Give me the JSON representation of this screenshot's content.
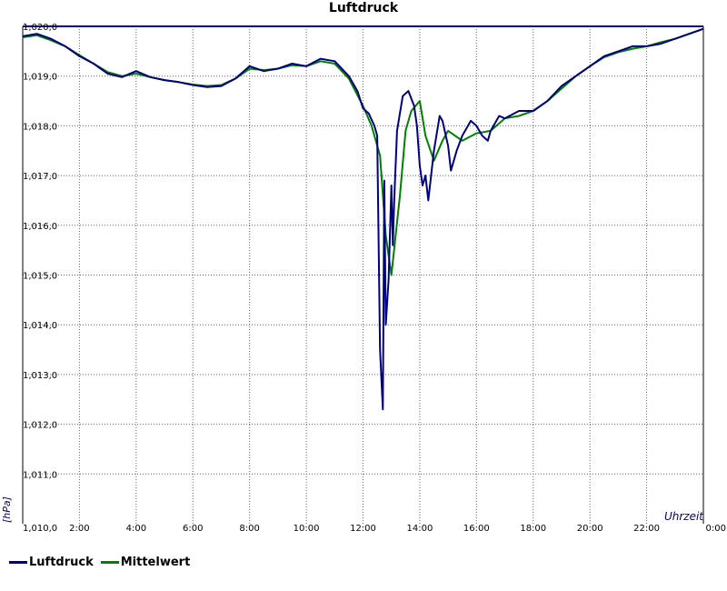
{
  "chart_data": {
    "type": "line",
    "title": "Luftdruck",
    "ylabel": "[hPa]",
    "xlabel": "Uhrzeit",
    "ylim": [
      1010.0,
      1020.0
    ],
    "xlim": [
      0,
      24
    ],
    "y_ticks": [
      "1,010,0",
      "1,011,0",
      "1,012,0",
      "1,013,0",
      "1,014,0",
      "1,015,0",
      "1,016,0",
      "1,017,0",
      "1,018,0",
      "1,019,0",
      "1,020,0"
    ],
    "x_ticks": [
      "2:00",
      "4:00",
      "6:00",
      "8:00",
      "10:00",
      "12:00",
      "14:00",
      "16:00",
      "18:00",
      "20:00",
      "22:00",
      "0:00"
    ],
    "grid": true,
    "legend_position": "bottom-left",
    "series": [
      {
        "name": "Luftdruck",
        "color": "#000080",
        "x": [
          0.0,
          0.5,
          1.0,
          1.5,
          2.0,
          2.5,
          3.0,
          3.5,
          4.0,
          4.5,
          5.0,
          5.5,
          6.0,
          6.5,
          7.0,
          7.5,
          8.0,
          8.5,
          9.0,
          9.5,
          10.0,
          10.5,
          11.0,
          11.5,
          11.8,
          12.0,
          12.2,
          12.4,
          12.5,
          12.6,
          12.7,
          12.75,
          12.8,
          12.9,
          13.0,
          13.05,
          13.1,
          13.2,
          13.4,
          13.6,
          13.8,
          13.9,
          14.0,
          14.1,
          14.2,
          14.3,
          14.5,
          14.7,
          14.8,
          15.0,
          15.1,
          15.3,
          15.5,
          15.8,
          16.0,
          16.2,
          16.4,
          16.5,
          16.8,
          17.0,
          17.5,
          18.0,
          18.5,
          19.0,
          19.5,
          20.0,
          20.5,
          21.0,
          21.5,
          22.0,
          22.5,
          23.0,
          23.5,
          24.0
        ],
        "y": [
          1019.8,
          1019.85,
          1019.75,
          1019.6,
          1019.4,
          1019.25,
          1019.05,
          1018.98,
          1019.1,
          1018.98,
          1018.92,
          1018.88,
          1018.82,
          1018.78,
          1018.8,
          1018.95,
          1019.2,
          1019.1,
          1019.15,
          1019.25,
          1019.2,
          1019.35,
          1019.3,
          1019.0,
          1018.7,
          1018.35,
          1018.25,
          1018.0,
          1017.8,
          1013.5,
          1012.3,
          1016.9,
          1014.0,
          1014.9,
          1016.8,
          1015.6,
          1016.5,
          1017.9,
          1018.6,
          1018.7,
          1018.4,
          1018.0,
          1017.2,
          1016.8,
          1017.0,
          1016.5,
          1017.5,
          1018.2,
          1018.1,
          1017.6,
          1017.1,
          1017.5,
          1017.8,
          1018.1,
          1018.0,
          1017.8,
          1017.7,
          1017.9,
          1018.2,
          1018.15,
          1018.3,
          1018.3,
          1018.5,
          1018.8,
          1019.0,
          1019.2,
          1019.4,
          1019.5,
          1019.6,
          1019.6,
          1019.65,
          1019.75,
          1019.85,
          1019.95
        ]
      },
      {
        "name": "Mittelwert",
        "color": "#008000",
        "x": [
          0.0,
          0.5,
          1.0,
          1.5,
          2.0,
          2.5,
          3.0,
          3.5,
          4.0,
          4.5,
          5.0,
          5.5,
          6.0,
          6.5,
          7.0,
          7.5,
          8.0,
          8.5,
          9.0,
          9.5,
          10.0,
          10.5,
          11.0,
          11.5,
          12.0,
          12.3,
          12.6,
          12.8,
          13.0,
          13.3,
          13.5,
          13.7,
          14.0,
          14.2,
          14.5,
          14.8,
          15.0,
          15.5,
          16.0,
          16.5,
          17.0,
          17.5,
          18.0,
          18.5,
          19.0,
          19.5,
          20.0,
          20.5,
          21.0,
          21.5,
          22.0,
          22.5,
          23.0,
          23.5,
          24.0
        ],
        "y": [
          1019.78,
          1019.82,
          1019.72,
          1019.6,
          1019.42,
          1019.25,
          1019.08,
          1019.0,
          1019.05,
          1018.98,
          1018.92,
          1018.88,
          1018.83,
          1018.8,
          1018.82,
          1018.95,
          1019.15,
          1019.12,
          1019.15,
          1019.22,
          1019.2,
          1019.3,
          1019.25,
          1018.95,
          1018.4,
          1018.0,
          1017.4,
          1015.8,
          1015.0,
          1016.6,
          1017.9,
          1018.3,
          1018.5,
          1017.8,
          1017.3,
          1017.7,
          1017.9,
          1017.7,
          1017.85,
          1017.9,
          1018.15,
          1018.2,
          1018.3,
          1018.5,
          1018.75,
          1019.0,
          1019.2,
          1019.38,
          1019.48,
          1019.55,
          1019.6,
          1019.68,
          1019.75,
          1019.85,
          1019.95
        ]
      }
    ]
  }
}
